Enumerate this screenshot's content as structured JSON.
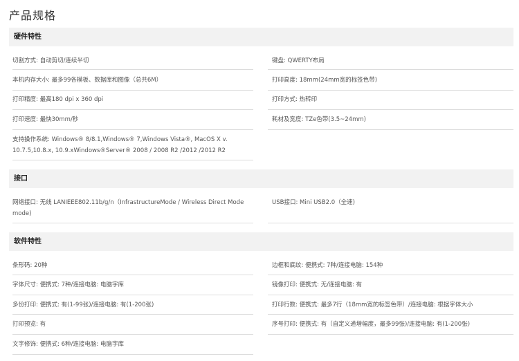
{
  "page_title": "产品规格",
  "sections": [
    {
      "heading": "硬件特性",
      "rows": [
        {
          "left": "切割方式: 自动剪切/连续半切",
          "right": "键盘: QWERTY布局"
        },
        {
          "left": "本机内存大小: 最多99各模板、数据库和图像（总共6M）",
          "right": "打印高度: 18mm(24mm宽的标签色带)"
        },
        {
          "left": "打印精度: 最高180 dpi x 360 dpi",
          "right": "打印方式: 热转印"
        },
        {
          "left": "打印速度: 最快30mm/秒",
          "right": "耗材及宽度: TZe色带(3.5~24mm)"
        },
        {
          "left": "支持操作系统: Windows® 8/8.1,Windows® 7,Windows Vista®, MacOS X v. 10.7.5,10.8.x, 10.9.xWindows®Server® 2008 / 2008 R2 /2012 /2012 R2",
          "right": ""
        }
      ]
    },
    {
      "heading": "接口",
      "rows": [
        {
          "left": "网络接口: 无线 LANIEEE802.11b/g/n（InfrastructureMode / Wireless Direct Mode mode)",
          "right": "USB接口: Mini USB2.0（全速)"
        }
      ]
    },
    {
      "heading": "软件特性",
      "rows": [
        {
          "left": "条形码: 20种",
          "right": "边框和底纹: 便携式: 7种/连接电脑: 154种"
        },
        {
          "left": "字体尺寸: 便携式: 7种/连接电脑: 电脑字库",
          "right": "镜像打印: 便携式: 无/连接电脑: 有"
        },
        {
          "left": "多份打印: 便携式: 有(1-99张)/连接电脑: 有(1-200张)",
          "right": "打印行数: 便携式: 最多7行（18mm宽的标签色带）/连接电脑: 根据字体大小"
        },
        {
          "left": "打印预览: 有",
          "right": "序号打印: 便携式: 有（自定义递增幅度，最多99张)/连接电脑: 有(1-200张)"
        },
        {
          "left": "文字修饰: 便携式: 6种/连接电脑: 电脑字库",
          "right": ""
        }
      ]
    }
  ]
}
